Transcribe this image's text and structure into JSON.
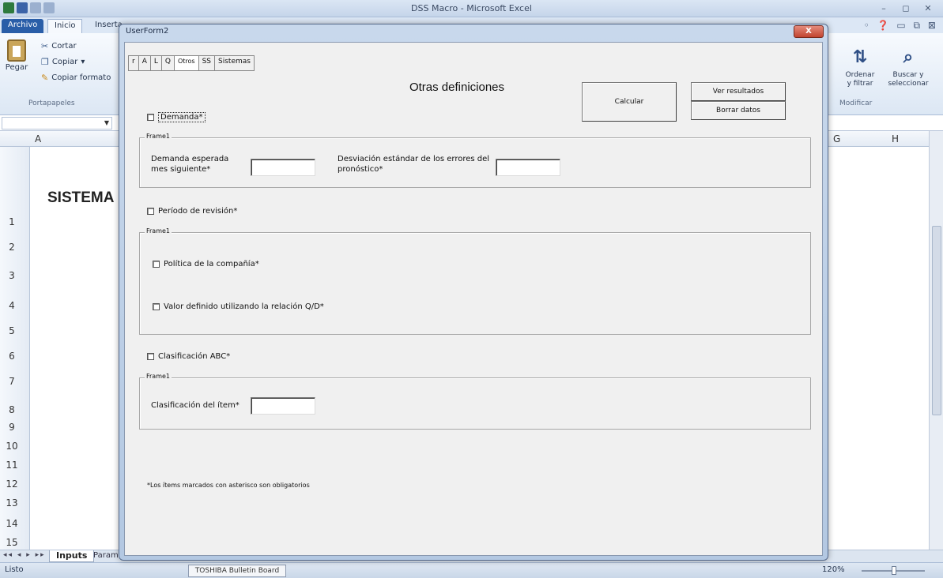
{
  "excel": {
    "window_title": "DSS Macro - Microsoft Excel",
    "ribbon_tabs": [
      "Archivo",
      "Inicio",
      "Inserta"
    ],
    "clipboard": {
      "paste_label": "Pegar",
      "cut_label": "Cortar",
      "copy_label": "Copiar",
      "format_painter_label": "Copiar formato",
      "group_label": "Portapapeles"
    },
    "editing": {
      "sort_label_1": "Ordenar",
      "sort_label_2": "y filtrar",
      "find_label_1": "Buscar y",
      "find_label_2": "seleccionar",
      "group_label": "Modificar"
    },
    "columns": [
      "A",
      "G",
      "H"
    ],
    "rows": [
      "1",
      "2",
      "3",
      "4",
      "5",
      "6",
      "7",
      "8",
      "9",
      "10",
      "11",
      "12",
      "13",
      "14",
      "15"
    ],
    "sheet_heading": "SISTEMA D",
    "sheet_tabs": [
      "Inputs",
      "Param"
    ],
    "status_text": "Listo",
    "taskbar_item": "TOSHIBA Bulletin Board",
    "zoom": "120%"
  },
  "userform": {
    "title": "UserForm2",
    "close_label": "X",
    "tabs": [
      "r",
      "A",
      "L",
      "Q",
      "Otros",
      "SS",
      "Sistemas"
    ],
    "active_tab": "Otros",
    "heading": "Otras definiciones",
    "buttons": {
      "calcular": "Calcular",
      "ver_resultados": "Ver resultados",
      "borrar_datos": "Borrar datos"
    },
    "demanda": {
      "checkbox_label": "Demanda*",
      "frame_label": "Frame1",
      "expected_label_1": "Demanda esperada",
      "expected_label_2": "mes siguiente*",
      "expected_value": "",
      "stddev_label_1": "Desviación estándar de los errores del",
      "stddev_label_2": "pronóstico*",
      "stddev_value": ""
    },
    "periodo": {
      "checkbox_label": "Período de revisión*",
      "frame_label": "Frame1",
      "option_1": "Política de la compañía*",
      "option_2": "Valor definido utilizando la relación Q/D*"
    },
    "abc": {
      "checkbox_label": "Clasificación ABC*",
      "frame_label": "Frame1",
      "item_label": "Clasificación del ítem*",
      "item_value": ""
    },
    "footnote": "*Los ítems marcados con asterisco son obligatorios"
  }
}
